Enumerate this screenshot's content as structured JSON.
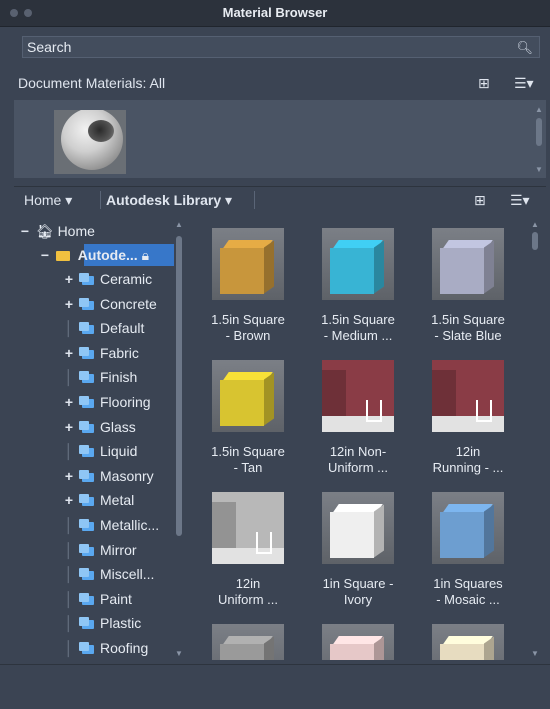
{
  "window": {
    "title": "Material Browser"
  },
  "search": {
    "placeholder": "Search",
    "icon": "search-icon"
  },
  "document_materials": {
    "label": "Document Materials: All"
  },
  "library_bar": {
    "home_label": "Home",
    "library_label": "Autodesk Library"
  },
  "tree": {
    "home": "Home",
    "library": "Autode...",
    "items": [
      {
        "label": "Ceramic",
        "expandable": true
      },
      {
        "label": "Concrete",
        "expandable": true
      },
      {
        "label": "Default",
        "expandable": false
      },
      {
        "label": "Fabric",
        "expandable": true
      },
      {
        "label": "Finish",
        "expandable": false
      },
      {
        "label": "Flooring",
        "expandable": true
      },
      {
        "label": "Glass",
        "expandable": true
      },
      {
        "label": "Liquid",
        "expandable": false
      },
      {
        "label": "Masonry",
        "expandable": true
      },
      {
        "label": "Metal",
        "expandable": true
      },
      {
        "label": "Metallic...",
        "expandable": false
      },
      {
        "label": "Mirror",
        "expandable": false
      },
      {
        "label": "Miscell...",
        "expandable": false
      },
      {
        "label": "Paint",
        "expandable": false
      },
      {
        "label": "Plastic",
        "expandable": false
      },
      {
        "label": "Roofing",
        "expandable": false
      }
    ]
  },
  "materials": [
    {
      "line1": "1.5in Square",
      "line2": "- Brown",
      "color": "#c8963c",
      "kind": "cube"
    },
    {
      "line1": "1.5in Square",
      "line2": "- Medium ...",
      "color": "#38b4d4",
      "kind": "cube"
    },
    {
      "line1": "1.5in Square",
      "line2": "- Slate Blue",
      "color": "#a9acc4",
      "kind": "cube"
    },
    {
      "line1": "1.5in Square",
      "line2": "- Tan",
      "color": "#d8c430",
      "kind": "cube"
    },
    {
      "line1": "12in Non-",
      "line2": "Uniform ...",
      "color": "#8a3c46",
      "kind": "wall"
    },
    {
      "line1": "12in",
      "line2": "Running - ...",
      "color": "#8a3c46",
      "kind": "wall"
    },
    {
      "line1": "12in",
      "line2": "Uniform ...",
      "color": "#b8b8b8",
      "kind": "wall"
    },
    {
      "line1": "1in Square -",
      "line2": "Ivory",
      "color": "#efefef",
      "kind": "cube"
    },
    {
      "line1": "1in Squares",
      "line2": "- Mosaic ...",
      "color": "#6d9ed0",
      "kind": "cube"
    },
    {
      "line1": "",
      "line2": "",
      "color": "#9a9a9a",
      "kind": "cube"
    },
    {
      "line1": "",
      "line2": "",
      "color": "#e6c8c8",
      "kind": "cube"
    },
    {
      "line1": "",
      "line2": "",
      "color": "#e7dcc0",
      "kind": "cube"
    }
  ]
}
